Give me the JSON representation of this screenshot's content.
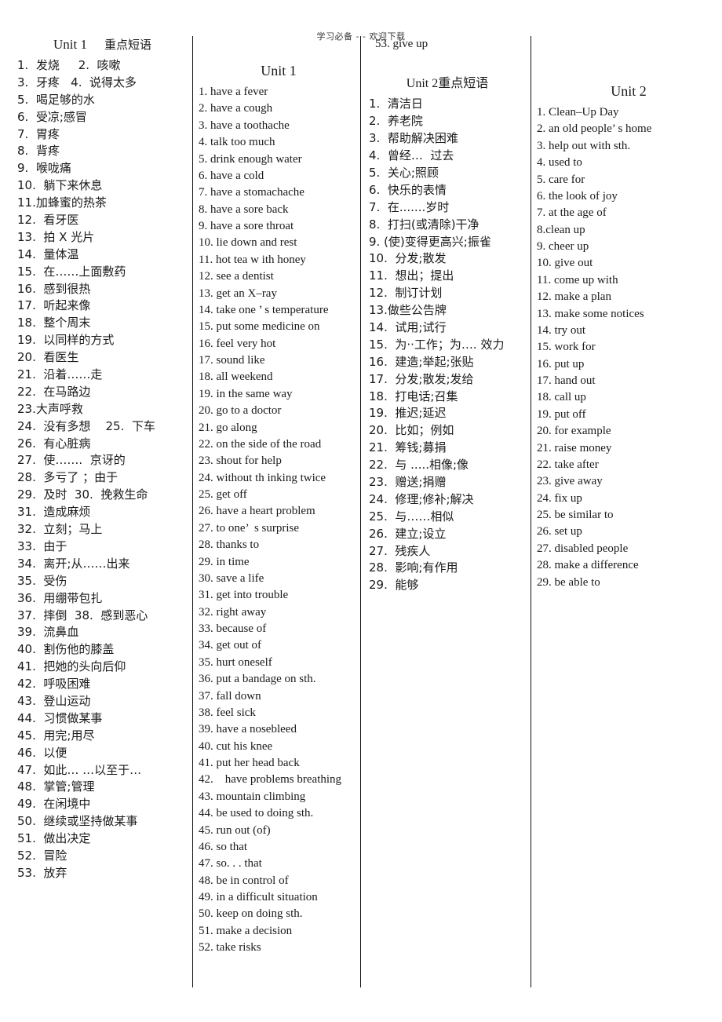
{
  "header": {
    "watermark": "学习必备 - - 欢迎下载"
  },
  "columns": {
    "col1": {
      "title": "Unit 1",
      "subtitle": "重点短语",
      "items": [
        "1.  发烧     2.  咳嗽",
        "3.  牙疼   4.  说得太多",
        "5.  喝足够的水",
        "6.  受凉;感冒",
        "7.  胃疼",
        "8.  背疼",
        "9.  喉咙痛",
        "10.  躺下来休息",
        "11.加蜂蜜的热茶",
        "12.  看牙医",
        "13.  拍 X 光片",
        "14.  量体温",
        "15.  在……上面敷药",
        "16.  感到很热",
        "17.  听起来像",
        "18.  整个周末",
        "19.  以同样的方式",
        "20.  看医生",
        "21.  沿着……走",
        "22.  在马路边",
        "23.大声呼救",
        "24.  没有多想    25.  下车",
        "26.  有心脏病",
        "27.  使…….  京讶的",
        "28.  多亏了 ；由于",
        "29.  及时  30.  挽救生命",
        "31.  造成麻烦",
        "32.  立刻；马上",
        "33.  由于",
        "34.  离开;从……出来",
        "35.  受伤",
        "36.  用绷带包扎",
        "37.  摔倒  38.  感到恶心",
        "39.  流鼻血",
        "40.  割伤他的膝盖",
        "41.  把她的头向后仰",
        "42.  呼吸困难",
        "43.  登山运动",
        "44.  习惯做某事",
        "45.  用完;用尽",
        "46.  以便",
        "47.  如此… …以至于…",
        "48.  掌管;管理",
        "49.  在闲境中",
        "50.  继续或坚持做某事",
        "51.  做出决定",
        "52.  冒险",
        "53.  放弃"
      ]
    },
    "col2": {
      "title": "Unit 1",
      "items": [
        "1. have a fever",
        "2. have a cough",
        "3. have a toothache",
        "4. talk too much",
        "5. drink enough water",
        "6. have a cold",
        "7. have a stomachache",
        "8. have a sore back",
        "9. have a sore throat",
        "10. lie down and rest",
        "11. hot tea w ith honey",
        "12. see a dentist",
        "13. get an X–ray",
        "14. take one ’ s temperature",
        "15. put some medicine on",
        "16. feel very hot",
        "17. sound like",
        "18. all weekend",
        "19. in the same way",
        "20. go to a doctor",
        "21. go along",
        "22. on the side of the road",
        "23. shout for help",
        "24. without th inking twice",
        "25. get off",
        "26. have a heart problem",
        "27. to one’  s surprise",
        "28. thanks to",
        "29. in time",
        "30. save a life",
        "31. get into trouble",
        "32. right away",
        "33. because of",
        "34. get out of",
        "35. hurt oneself",
        "36. put a bandage on sth.",
        "37. fall down",
        "38. feel sick",
        "39. have a nosebleed",
        "40. cut his knee",
        "41. put her head back",
        "42.    have problems breathing",
        "43. mountain climbing",
        "44. be used to doing sth.",
        "45. run out (of)",
        "46. so that",
        "47. so. . . that",
        "48. be in control of",
        "49. in a difficult situation",
        "50. keep on doing sth.",
        "51. make a decision",
        "52. take risks"
      ]
    },
    "col3": {
      "carryover": "53. give up",
      "title": "Unit 2",
      "subtitle": "重点短语",
      "items": [
        "1.  清洁日",
        "2.  养老院",
        "3.  帮助解决困难",
        "4.  曾经…  过去",
        "5.  关心;照顾",
        "6.  快乐的表情",
        "7.  在.......岁时",
        "8.  打扫(或清除)干净",
        "9. (使)变得更高兴;振雀",
        "10.  分发;散发",
        "11.  想出；提出",
        "12.  制订计划",
        "13.做些公告牌",
        "14.  试用;试行",
        "15.  为··工作；为…. 效力",
        "16.  建造;举起;张贴",
        "17.  分发;散发;发给",
        "18.  打电话;召集",
        "19.  推迟;延迟",
        "20.  比如；例如",
        "21.  筹钱;募捐",
        "22.  与 .....相像;像",
        "23.  赠送;捐赠",
        "24.  修理;修补;解决",
        "25.  与……相似",
        "26.  建立;设立",
        "27.  残疾人",
        "28.  影响;有作用",
        "29.  能够"
      ]
    },
    "col4": {
      "title": "Unit 2",
      "items": [
        "1. Clean–Up Day",
        "2. an old people’ s home",
        "3. help out with sth.",
        "4. used to",
        "5. care for",
        "6. the look of joy",
        "7. at the age of",
        "8.clean up",
        "9. cheer up",
        "10. give out",
        "11. come up with",
        "12. make a plan",
        "13. make some notices",
        "14. try out",
        "15. work for",
        "16. put up",
        "17. hand out",
        "18. call up",
        "19. put off",
        "20. for example",
        "21. raise money",
        "22. take after",
        "23. give away",
        "24. fix up",
        "25. be similar to",
        "26. set up",
        "27. disabled people",
        "28. make a difference",
        "29. be able to"
      ]
    }
  }
}
